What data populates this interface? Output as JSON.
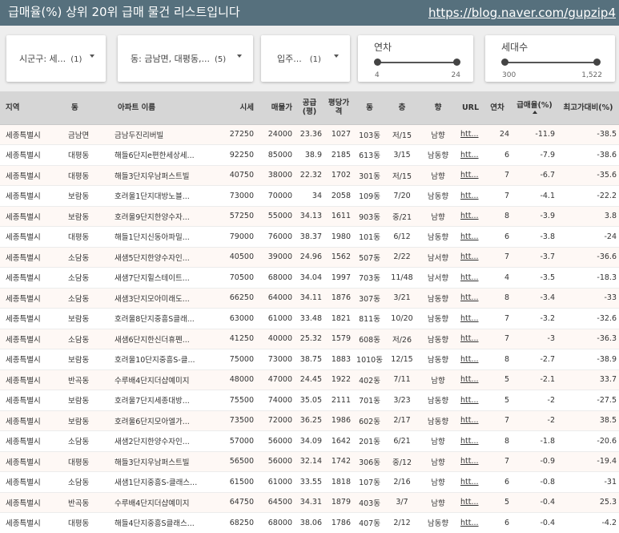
{
  "header": {
    "title": "급매율(%) 상위 20위 급매 물건 리스트입니다",
    "link": "https://blog.naver.com/gupzip4"
  },
  "filters": {
    "sigungu": {
      "label": "시군구: 세...",
      "count": "(1)"
    },
    "dong": {
      "label": "동: 금남면, 대평동,...",
      "count": "(5)"
    },
    "ipju": {
      "label": "입주...",
      "count": "(1)"
    },
    "year_slider": {
      "title": "연차",
      "min": "4",
      "max": "24"
    },
    "households_slider": {
      "title": "세대수",
      "min": "300",
      "max": "1,522"
    }
  },
  "table": {
    "columns": [
      "지역",
      "동",
      "아파트 이름",
      "시세",
      "매물가",
      "공급(평)",
      "평당가격",
      "동",
      "층",
      "향",
      "URL",
      "연차",
      "급매율(%)",
      "최고가대비(%)"
    ],
    "rows": [
      [
        "세종특별시",
        "금남면",
        "금남두진리버빌",
        "27250",
        "24000",
        "23.36",
        "1027",
        "103동",
        "저/15",
        "남향",
        "htt...",
        "24",
        "-11.9",
        "-38.5"
      ],
      [
        "세종특별시",
        "대평동",
        "해들6단지e편한세상세...",
        "92250",
        "85000",
        "38.9",
        "2185",
        "613동",
        "3/15",
        "남동향",
        "htt...",
        "6",
        "-7.9",
        "-38.6"
      ],
      [
        "세종특별시",
        "대평동",
        "해들3단지우남퍼스트빌",
        "40750",
        "38000",
        "22.32",
        "1702",
        "301동",
        "저/15",
        "남향",
        "htt...",
        "7",
        "-6.7",
        "-35.6"
      ],
      [
        "세종특별시",
        "보람동",
        "호려울1단지대방노블...",
        "73000",
        "70000",
        "34",
        "2058",
        "109동",
        "7/20",
        "남동향",
        "htt...",
        "7",
        "-4.1",
        "-22.2"
      ],
      [
        "세종특별시",
        "보람동",
        "호려울9단지한양수자...",
        "57250",
        "55000",
        "34.13",
        "1611",
        "903동",
        "중/21",
        "남향",
        "htt...",
        "8",
        "-3.9",
        "3.8"
      ],
      [
        "세종특별시",
        "대평동",
        "해들1단지신동아파밀...",
        "79000",
        "76000",
        "38.37",
        "1980",
        "101동",
        "6/12",
        "남동향",
        "htt...",
        "6",
        "-3.8",
        "-24"
      ],
      [
        "세종특별시",
        "소담동",
        "새샘5단지한양수자인...",
        "40500",
        "39000",
        "24.96",
        "1562",
        "507동",
        "2/22",
        "남서향",
        "htt...",
        "7",
        "-3.7",
        "-36.6"
      ],
      [
        "세종특별시",
        "소담동",
        "새샘7단지힐스테이트...",
        "70500",
        "68000",
        "34.04",
        "1997",
        "703동",
        "11/48",
        "남서향",
        "htt...",
        "4",
        "-3.5",
        "-18.3"
      ],
      [
        "세종특별시",
        "소담동",
        "새샘3단지모아미래도...",
        "66250",
        "64000",
        "34.11",
        "1876",
        "307동",
        "3/21",
        "남동향",
        "htt...",
        "8",
        "-3.4",
        "-33"
      ],
      [
        "세종특별시",
        "보람동",
        "호려울8단지중흥S클래...",
        "63000",
        "61000",
        "33.48",
        "1821",
        "811동",
        "10/20",
        "남동향",
        "htt...",
        "7",
        "-3.2",
        "-32.6"
      ],
      [
        "세종특별시",
        "소담동",
        "새샘6단지한신더휴펜...",
        "41250",
        "40000",
        "25.32",
        "1579",
        "608동",
        "저/26",
        "남동향",
        "htt...",
        "7",
        "-3",
        "-36.3"
      ],
      [
        "세종특별시",
        "보람동",
        "호려울10단지중흥S-클...",
        "75000",
        "73000",
        "38.75",
        "1883",
        "1010동",
        "12/15",
        "남동향",
        "htt...",
        "8",
        "-2.7",
        "-38.9"
      ],
      [
        "세종특별시",
        "반곡동",
        "수루배4단지더샵예미지",
        "48000",
        "47000",
        "24.45",
        "1922",
        "402동",
        "7/11",
        "남향",
        "htt...",
        "5",
        "-2.1",
        "33.7"
      ],
      [
        "세종특별시",
        "보람동",
        "호려울7단지세종대방...",
        "75500",
        "74000",
        "35.05",
        "2111",
        "701동",
        "3/23",
        "남동향",
        "htt...",
        "5",
        "-2",
        "-27.5"
      ],
      [
        "세종특별시",
        "보람동",
        "호려울6단지모아엘가...",
        "73500",
        "72000",
        "36.25",
        "1986",
        "602동",
        "2/17",
        "남동향",
        "htt...",
        "7",
        "-2",
        "38.5"
      ],
      [
        "세종특별시",
        "소담동",
        "새샘2단지한양수자인...",
        "57000",
        "56000",
        "34.09",
        "1642",
        "201동",
        "6/21",
        "남향",
        "htt...",
        "8",
        "-1.8",
        "-20.6"
      ],
      [
        "세종특별시",
        "대평동",
        "해들3단지우남퍼스트빌",
        "56500",
        "56000",
        "32.14",
        "1742",
        "306동",
        "중/12",
        "남향",
        "htt...",
        "7",
        "-0.9",
        "-19.4"
      ],
      [
        "세종특별시",
        "소담동",
        "새샘1단지중흥S-클래스...",
        "61500",
        "61000",
        "33.55",
        "1818",
        "107동",
        "2/16",
        "남향",
        "htt...",
        "6",
        "-0.8",
        "-31"
      ],
      [
        "세종특별시",
        "반곡동",
        "수루배4단지더샵예미지",
        "64750",
        "64500",
        "34.31",
        "1879",
        "403동",
        "3/7",
        "남향",
        "htt...",
        "5",
        "-0.4",
        "25.3"
      ],
      [
        "세종특별시",
        "대평동",
        "해들4단지중흥S클래스...",
        "68250",
        "68000",
        "38.06",
        "1786",
        "407동",
        "2/12",
        "남동향",
        "htt...",
        "6",
        "-0.4",
        "-4.2"
      ]
    ]
  },
  "colors": {
    "header_bg": "#56707d",
    "filter_bg": "#eeeeee",
    "table_header_bg": "#d6d6d6",
    "row_alt_bg": "#fef8f5"
  }
}
